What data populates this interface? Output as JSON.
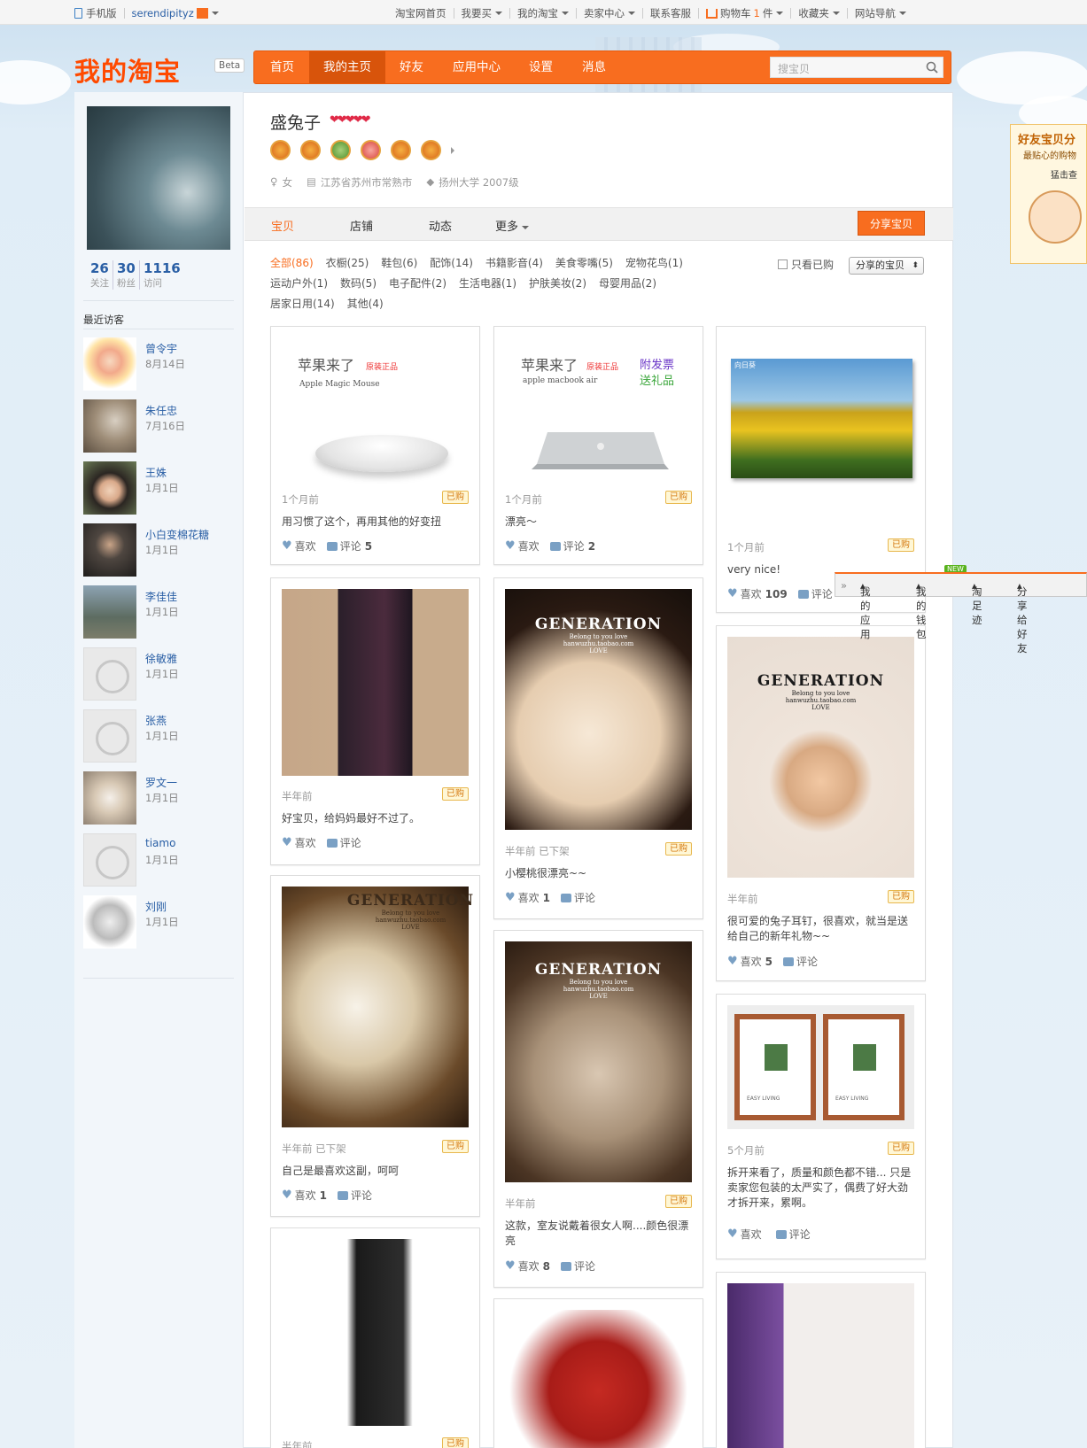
{
  "topbar": {
    "mobile": "手机版",
    "user": "serendipityz",
    "links": [
      "淘宝网首页",
      "我要买",
      "我的淘宝",
      "卖家中心",
      "联系客服",
      "购物车",
      "1",
      "件",
      "收藏夹",
      "网站导航"
    ]
  },
  "header": {
    "logo": "我的淘宝",
    "beta": "Beta",
    "nav": [
      "首页",
      "我的主页",
      "好友",
      "应用中心",
      "设置",
      "消息"
    ],
    "active_nav": "我的主页",
    "search_placeholder": "搜宝贝"
  },
  "profile": {
    "name": "盛兔子",
    "hearts": "❤❤❤❤❤",
    "gender": "女",
    "location": "江苏省苏州市常熟市",
    "school": "扬州大学 2007级",
    "stats": [
      {
        "n": "26",
        "l": "关注"
      },
      {
        "n": "30",
        "l": "粉丝"
      },
      {
        "n": "1116",
        "l": "访问"
      }
    ]
  },
  "sidebar": {
    "visitors_title": "最近访客",
    "visitors": [
      {
        "name": "曾令宇",
        "date": "8月14日"
      },
      {
        "name": "朱任忠",
        "date": "7月16日"
      },
      {
        "name": "王姝",
        "date": "1月1日"
      },
      {
        "name": "小白变棉花糖",
        "date": "1月1日"
      },
      {
        "name": "李佳佳",
        "date": "1月1日"
      },
      {
        "name": "徐敏雅",
        "date": "1月1日"
      },
      {
        "name": "张燕",
        "date": "1月1日"
      },
      {
        "name": "罗文一",
        "date": "1月1日"
      },
      {
        "name": "tiamo",
        "date": "1月1日"
      },
      {
        "name": "刘刚",
        "date": "1月1日"
      }
    ]
  },
  "tabs": [
    "宝贝",
    "店铺",
    "动态",
    "更多"
  ],
  "share_button": "分享宝贝",
  "filters": [
    "全部(86)",
    "衣橱(25)",
    "鞋包(6)",
    "配饰(14)",
    "书籍影音(4)",
    "美食零嘴(5)",
    "宠物花鸟(1)",
    "运动户外(1)",
    "数码(5)",
    "电子配件(2)",
    "生活电器(1)",
    "护肤美妆(2)",
    "母婴用品(2)",
    "居家日用(14)",
    "其他(4)"
  ],
  "only_bought": "只看已购",
  "sort_select": "分享的宝贝",
  "bought_tag": "已购",
  "like_label": "喜欢",
  "comment_label": "评论",
  "cards": [
    {
      "time": "1个月前",
      "comment": "用习惯了这个，再用其他的好变扭",
      "likes": "",
      "comments": "5",
      "img_title": "苹果来了",
      "img_tag": "原装正品",
      "img_sub": "Apple Magic Mouse"
    },
    {
      "time": "1个月前",
      "comment": "漂亮～",
      "likes": "",
      "comments": "2",
      "img_title": "苹果来了",
      "img_tag": "原装正品",
      "img_sub": "apple macbook air",
      "img_extra1": "附发票",
      "img_extra2": "送礼品"
    },
    {
      "time": "1个月前",
      "comment": "very nice!",
      "likes": "109",
      "comments": "",
      "img_label": "向日葵"
    },
    {
      "time": "半年前",
      "comment": "好宝贝，给妈妈最好不过了。",
      "likes": "",
      "comments": ""
    },
    {
      "time": "半年前 已下架",
      "comment": "小樱桃很漂亮~~",
      "likes": "1",
      "comments": ""
    },
    {
      "time": "半年前",
      "comment": "很可爱的兔子耳钉，很喜欢，就当是送给自己的新年礼物~~",
      "likes": "5",
      "comments": ""
    },
    {
      "time": "半年前 已下架",
      "comment": "自己是最喜欢这副，呵呵",
      "likes": "1",
      "comments": ""
    },
    {
      "time": "半年前",
      "comment": "这款，室友说戴着很女人啊....颜色很漂亮",
      "likes": "8",
      "comments": ""
    },
    {
      "time": "5个月前",
      "comment": "拆开来看了，质量和颜色都不错... 只是卖家您包装的太严实了，偶费了好大劲才拆开来，累啊。",
      "likes": "",
      "comments": ""
    },
    {
      "time": "半年前",
      "comment": "",
      "likes": "",
      "comments": ""
    }
  ],
  "generation": {
    "title": "GENERATION",
    "sub1": "Belong to you love",
    "sub2": "hanwuzhu.taobao.com",
    "sub3": "LOVE"
  },
  "frame_text": "EASY LIVING",
  "float_ad": {
    "t1": "好友宝贝分",
    "t2": "最贴心的购物",
    "t3": "猛击查"
  },
  "toolbar": {
    "new": "NEW",
    "items": [
      "我的应用",
      "我的钱包",
      "淘足迹",
      "分享给好友"
    ]
  }
}
